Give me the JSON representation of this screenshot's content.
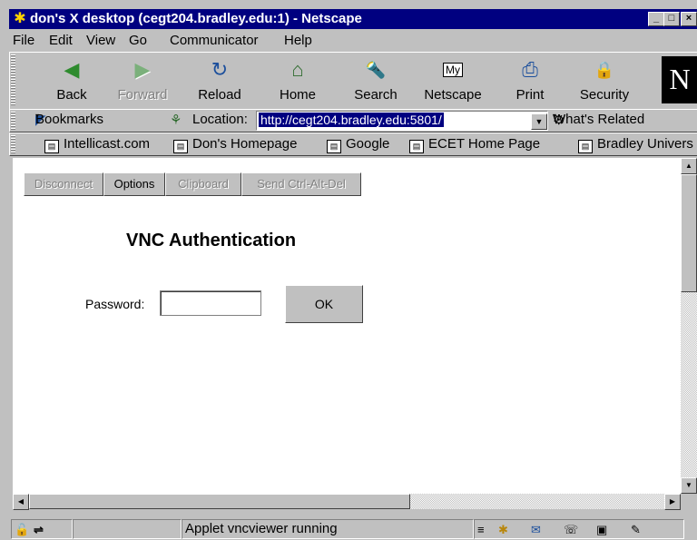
{
  "window": {
    "title": "don's X desktop (cegt204.bradley.edu:1) - Netscape",
    "controls": [
      "_",
      "□",
      "×"
    ]
  },
  "menu": [
    "File",
    "Edit",
    "View",
    "Go",
    "Communicator",
    "Help"
  ],
  "toolbar": {
    "buttons": [
      {
        "label": "Back",
        "icon": "back-arrow-icon",
        "glyph": "◀"
      },
      {
        "label": "Forward",
        "icon": "forward-arrow-icon",
        "glyph": "▶"
      },
      {
        "label": "Reload",
        "icon": "reload-icon",
        "glyph": "↻"
      },
      {
        "label": "Home",
        "icon": "home-icon",
        "glyph": "⌂"
      },
      {
        "label": "Search",
        "icon": "search-icon",
        "glyph": "🔦"
      },
      {
        "label": "Netscape",
        "icon": "my-netscape-icon",
        "glyph": "My"
      },
      {
        "label": "Print",
        "icon": "printer-icon",
        "glyph": "⎙"
      },
      {
        "label": "Security",
        "icon": "lock-icon",
        "glyph": "🔒"
      }
    ],
    "logo": "N"
  },
  "location": {
    "bookmarks_label": "Bookmarks",
    "location_label": "Location:",
    "url": "http://cegt204.bradley.edu:5801/",
    "whats_related": "What's Related"
  },
  "personal_toolbar": [
    "Intellicast.com",
    "Don's Homepage",
    "Google",
    "ECET Home Page",
    "Bradley Univers"
  ],
  "applet": {
    "buttons": [
      {
        "label": "Disconnect",
        "enabled": false
      },
      {
        "label": "Options",
        "enabled": true
      },
      {
        "label": "Clipboard",
        "enabled": false
      },
      {
        "label": "Send Ctrl-Alt-Del",
        "enabled": false
      }
    ],
    "heading": "VNC Authentication",
    "password_label": "Password:",
    "password_value": "",
    "ok_label": "OK"
  },
  "status": {
    "text": "Applet vncviewer running"
  }
}
